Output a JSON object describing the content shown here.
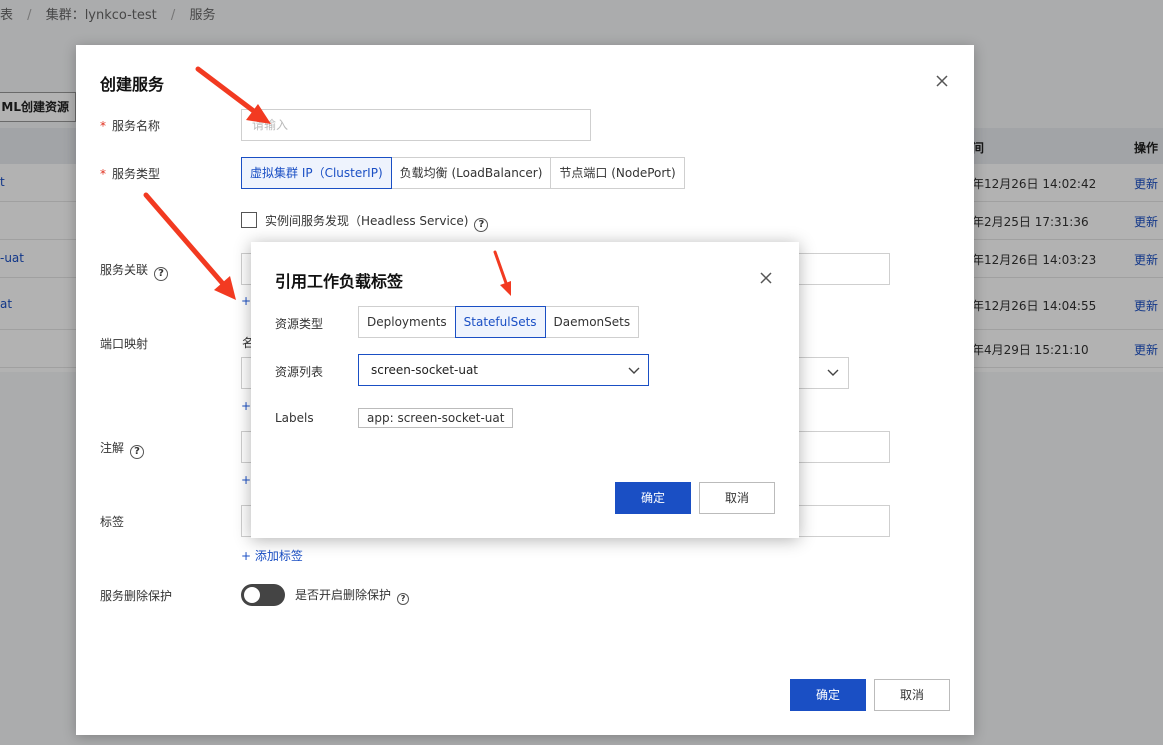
{
  "breadcrumb": {
    "prefix": "表",
    "sep": "/",
    "cluster": "集群：lynkco-test",
    "page": "服务"
  },
  "bg": {
    "yaml_button": "ML创建资源",
    "headers": {
      "time": "间",
      "ops": "操作"
    },
    "rows": [
      {
        "name": "t",
        "time": "年12月26日 14:02:42",
        "op": "更新"
      },
      {
        "name": "",
        "time": "年2月25日 17:31:36",
        "op": "更新"
      },
      {
        "name": "-uat",
        "time": "年12月26日 14:03:23",
        "op": "更新"
      },
      {
        "name": "at",
        "time": "年12月26日 14:04:55",
        "op": "更新"
      },
      {
        "name": "",
        "time": "年4月29日 15:21:10",
        "op": "更新"
      }
    ]
  },
  "dialog": {
    "title": "创建服务",
    "required_mark": "*",
    "service_name": {
      "label": "服务名称",
      "placeholder": "请输入"
    },
    "service_type": {
      "label": "服务类型",
      "options": [
        "虚拟集群 IP（ClusterIP)",
        "负载均衡 (LoadBalancer)",
        "节点端口 (NodePort)"
      ],
      "selected": 0
    },
    "headless": {
      "label": "实例间服务发现（Headless Service)"
    },
    "association": {
      "label": "服务关联"
    },
    "port_mapping": {
      "label": "端口映射",
      "col_name": "名"
    },
    "annotation": {
      "label": "注解"
    },
    "labels": {
      "label": "标签",
      "add": "+ 添加标签"
    },
    "delete_protect": {
      "label": "服务删除保护",
      "toggle_text": "是否开启删除保护"
    },
    "help": "?",
    "plus": "+",
    "confirm": "确定",
    "cancel": "取消"
  },
  "inner": {
    "title": "引用工作负载标签",
    "resource_type": {
      "label": "资源类型",
      "options": [
        "Deployments",
        "StatefulSets",
        "DaemonSets"
      ],
      "selected": 1
    },
    "resource_list": {
      "label": "资源列表",
      "value": "screen-socket-uat"
    },
    "labels": {
      "label": "Labels",
      "tag": "app: screen-socket-uat"
    },
    "confirm": "确定",
    "cancel": "取消"
  },
  "colors": {
    "primary": "#1a4fc4",
    "arrow": "#f23a21",
    "required": "#e0301e"
  }
}
